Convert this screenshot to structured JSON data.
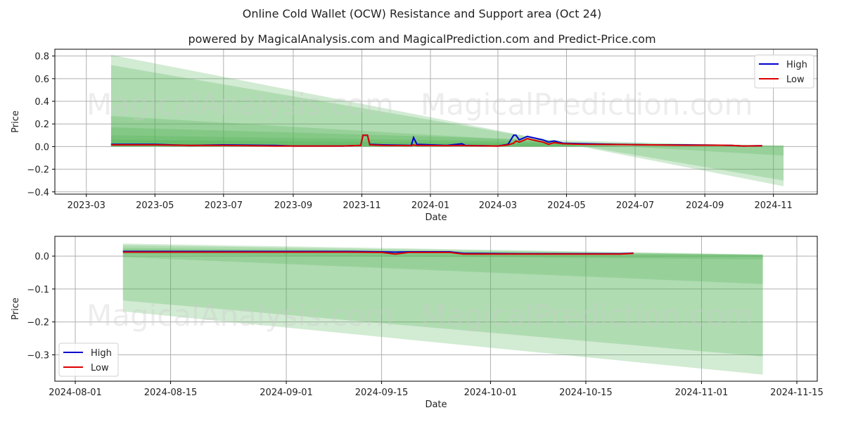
{
  "header": {
    "title": "Online Cold Wallet (OCW) Resistance and Support area (Oct 24)",
    "subtitle": "powered by MagicalAnalysis.com and MagicalPrediction.com and Predict-Price.com"
  },
  "watermarks": [
    "MagicalAnalysis.com",
    "MagicalPrediction.com"
  ],
  "colors": {
    "high": "#0000cc",
    "low": "#dd0000",
    "band": "#4caf50"
  },
  "chart_data": [
    {
      "type": "line",
      "title": "",
      "xlabel": "Date",
      "ylabel": "Price",
      "ylim": [
        -0.42,
        0.86
      ],
      "xlim": [
        "2023-02-01",
        "2024-12-10"
      ],
      "yticks": [
        -0.4,
        -0.2,
        0.0,
        0.2,
        0.4,
        0.6,
        0.8
      ],
      "ytick_labels": [
        "−0.4",
        "−0.2",
        "0.0",
        "0.2",
        "0.4",
        "0.6",
        "0.8"
      ],
      "xticks": [
        "2023-03-01",
        "2023-05-01",
        "2023-07-01",
        "2023-09-01",
        "2023-11-01",
        "2024-01-01",
        "2024-03-01",
        "2024-05-01",
        "2024-07-01",
        "2024-09-01",
        "2024-11-01"
      ],
      "xtick_labels": [
        "2023-03",
        "2023-05",
        "2023-07",
        "2023-09",
        "2023-11",
        "2024-01",
        "2024-03",
        "2024-05",
        "2024-07",
        "2024-09",
        "2024-11"
      ],
      "grid": true,
      "legend": {
        "placement": "top-right",
        "entries": [
          "High",
          "Low"
        ]
      },
      "bands": [
        {
          "x": [
            "2023-03-23",
            "2024-11-10"
          ],
          "upper": [
            0.81,
            -0.35
          ],
          "lower": [
            0.0,
            0.0
          ],
          "alpha": 0.25
        },
        {
          "x": [
            "2023-03-23",
            "2024-11-10"
          ],
          "upper": [
            0.72,
            -0.3
          ],
          "lower": [
            0.0,
            0.0
          ],
          "alpha": 0.25
        },
        {
          "x": [
            "2023-03-23",
            "2024-11-10"
          ],
          "upper": [
            0.27,
            -0.08
          ],
          "lower": [
            0.0,
            0.0
          ],
          "alpha": 0.25
        },
        {
          "x": [
            "2023-03-23",
            "2024-11-10"
          ],
          "upper": [
            0.17,
            0.0
          ],
          "lower": [
            0.0,
            0.0
          ],
          "alpha": 0.25
        },
        {
          "x": [
            "2023-03-23",
            "2024-11-10"
          ],
          "upper": [
            0.1,
            0.01
          ],
          "lower": [
            0.0,
            0.0
          ],
          "alpha": 0.25
        },
        {
          "x": [
            "2023-03-23",
            "2024-11-10"
          ],
          "upper": [
            0.06,
            0.01
          ],
          "lower": [
            0.0,
            0.0
          ],
          "alpha": 0.25
        }
      ],
      "series": [
        {
          "name": "High",
          "x": [
            "2023-03-23",
            "2023-05-01",
            "2023-06-01",
            "2023-07-01",
            "2023-08-15",
            "2023-09-01",
            "2023-10-15",
            "2023-10-31",
            "2023-11-02",
            "2023-11-06",
            "2023-11-08",
            "2023-11-20",
            "2023-12-15",
            "2023-12-17",
            "2023-12-20",
            "2024-01-15",
            "2024-01-29",
            "2024-02-01",
            "2024-03-01",
            "2024-03-10",
            "2024-03-15",
            "2024-03-17",
            "2024-03-20",
            "2024-03-25",
            "2024-03-27",
            "2024-04-05",
            "2024-04-10",
            "2024-04-15",
            "2024-04-20",
            "2024-04-28",
            "2024-05-15",
            "2024-06-15",
            "2024-07-15",
            "2024-08-15",
            "2024-09-15",
            "2024-09-25",
            "2024-10-05",
            "2024-10-22"
          ],
          "values": [
            0.02,
            0.02,
            0.01,
            0.015,
            0.01,
            0.005,
            0.005,
            0.01,
            0.1,
            0.1,
            0.02,
            0.015,
            0.01,
            0.08,
            0.02,
            0.01,
            0.025,
            0.01,
            0.005,
            0.02,
            0.1,
            0.1,
            0.06,
            0.08,
            0.09,
            0.07,
            0.06,
            0.04,
            0.05,
            0.03,
            0.025,
            0.02,
            0.015,
            0.015,
            0.012,
            0.01,
            0.005,
            0.008
          ]
        },
        {
          "name": "Low",
          "x": [
            "2023-03-23",
            "2023-05-01",
            "2023-06-01",
            "2023-07-01",
            "2023-08-15",
            "2023-09-01",
            "2023-10-15",
            "2023-10-31",
            "2023-11-02",
            "2023-11-06",
            "2023-11-08",
            "2023-11-20",
            "2023-12-15",
            "2023-12-17",
            "2023-12-20",
            "2024-01-15",
            "2024-01-29",
            "2024-02-01",
            "2024-03-01",
            "2024-03-10",
            "2024-03-15",
            "2024-03-17",
            "2024-03-20",
            "2024-03-25",
            "2024-03-27",
            "2024-04-05",
            "2024-04-10",
            "2024-04-15",
            "2024-04-20",
            "2024-04-28",
            "2024-05-15",
            "2024-06-15",
            "2024-07-15",
            "2024-08-15",
            "2024-09-15",
            "2024-09-25",
            "2024-10-05",
            "2024-10-22"
          ],
          "values": [
            0.015,
            0.015,
            0.01,
            0.01,
            0.005,
            0.005,
            0.005,
            0.01,
            0.1,
            0.1,
            0.015,
            0.01,
            0.008,
            0.015,
            0.01,
            0.008,
            0.01,
            0.008,
            0.005,
            0.015,
            0.03,
            0.05,
            0.04,
            0.06,
            0.07,
            0.05,
            0.04,
            0.02,
            0.035,
            0.025,
            0.02,
            0.018,
            0.015,
            0.012,
            0.012,
            0.01,
            0.005,
            0.007
          ]
        }
      ]
    },
    {
      "type": "line",
      "title": "",
      "xlabel": "Date",
      "ylabel": "Price",
      "ylim": [
        -0.38,
        0.06
      ],
      "xlim": [
        "2024-07-29",
        "2024-11-18"
      ],
      "yticks": [
        -0.3,
        -0.2,
        -0.1,
        0.0
      ],
      "ytick_labels": [
        "−0.3",
        "−0.2",
        "−0.1",
        "0.0"
      ],
      "xticks": [
        "2024-08-01",
        "2024-08-15",
        "2024-09-01",
        "2024-09-15",
        "2024-10-01",
        "2024-10-15",
        "2024-11-01",
        "2024-11-15"
      ],
      "xtick_labels": [
        "2024-08-01",
        "2024-08-15",
        "2024-09-01",
        "2024-09-15",
        "2024-10-01",
        "2024-10-15",
        "2024-11-01",
        "2024-11-15"
      ],
      "grid": true,
      "legend": {
        "placement": "bottom-left",
        "entries": [
          "High",
          "Low"
        ]
      },
      "bands": [
        {
          "x": [
            "2024-08-08",
            "2024-11-10"
          ],
          "upper": [
            0.038,
            0.005
          ],
          "lower": [
            -0.168,
            -0.36
          ],
          "alpha": 0.25
        },
        {
          "x": [
            "2024-08-08",
            "2024-11-10"
          ],
          "upper": [
            0.033,
            0.004
          ],
          "lower": [
            -0.135,
            -0.305
          ],
          "alpha": 0.25
        },
        {
          "x": [
            "2024-08-08",
            "2024-11-10"
          ],
          "upper": [
            0.025,
            0.004
          ],
          "lower": [
            -0.003,
            -0.085
          ],
          "alpha": 0.25
        },
        {
          "x": [
            "2024-08-08",
            "2024-11-10"
          ],
          "upper": [
            0.02,
            0.004
          ],
          "lower": [
            0.005,
            -0.01
          ],
          "alpha": 0.25
        }
      ],
      "series": [
        {
          "name": "High",
          "x": [
            "2024-08-08",
            "2024-09-01",
            "2024-09-10",
            "2024-09-15",
            "2024-09-17",
            "2024-09-19",
            "2024-09-25",
            "2024-09-27",
            "2024-10-05",
            "2024-10-15",
            "2024-10-20",
            "2024-10-22"
          ],
          "values": [
            0.014,
            0.014,
            0.014,
            0.013,
            0.012,
            0.013,
            0.013,
            0.008,
            0.007,
            0.007,
            0.007,
            0.009
          ]
        },
        {
          "name": "Low",
          "x": [
            "2024-08-08",
            "2024-09-01",
            "2024-09-10",
            "2024-09-15",
            "2024-09-17",
            "2024-09-19",
            "2024-09-25",
            "2024-09-27",
            "2024-10-05",
            "2024-10-15",
            "2024-10-20",
            "2024-10-22"
          ],
          "values": [
            0.012,
            0.012,
            0.012,
            0.011,
            0.006,
            0.011,
            0.011,
            0.006,
            0.006,
            0.006,
            0.006,
            0.008
          ]
        }
      ]
    }
  ]
}
